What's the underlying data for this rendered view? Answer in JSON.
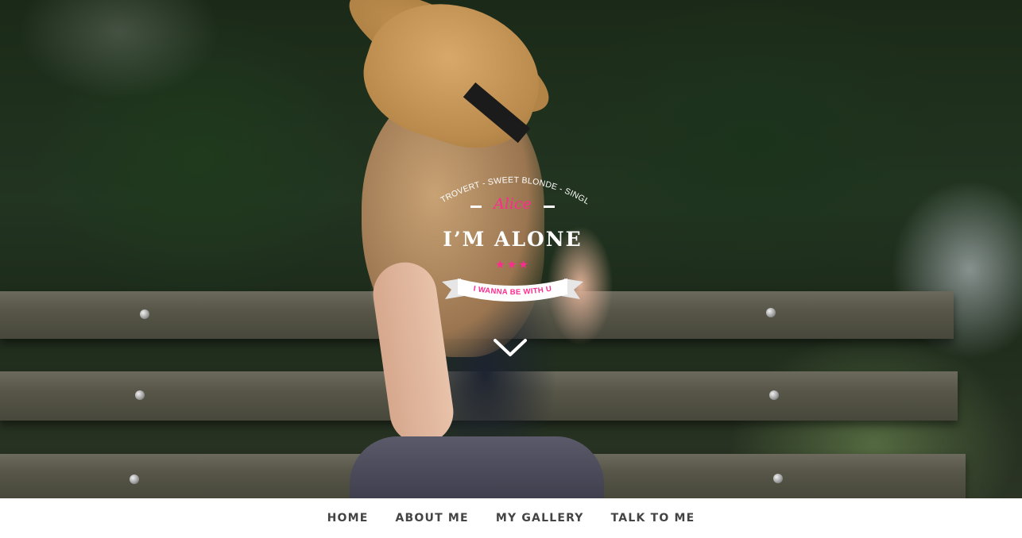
{
  "badge": {
    "arc_text": "INTROVERT - SWEET BLONDE - SINGLE",
    "name": "Alice",
    "title": "I’M ALONE",
    "stars": "★★★",
    "ribbon_text": "I WANNA BE WITH U"
  },
  "nav": {
    "items": [
      {
        "label": "HOME"
      },
      {
        "label": "ABOUT ME"
      },
      {
        "label": "MY GALLERY"
      },
      {
        "label": "TALK TO ME"
      }
    ]
  },
  "colors": {
    "accent": "#ff2a8f",
    "nav_text": "#444444",
    "nav_bg": "#ffffff"
  },
  "icons": {
    "scroll": "chevron-down-icon"
  }
}
